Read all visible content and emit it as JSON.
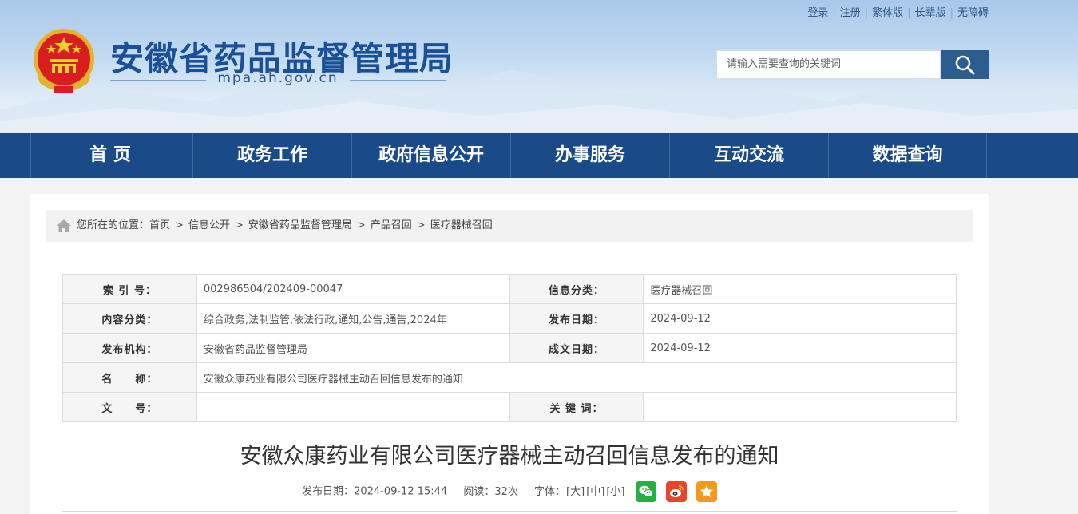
{
  "toplinks": [
    "登录",
    "注册",
    "繁体版",
    "长辈版",
    "无障碍"
  ],
  "site": {
    "title": "安徽省药品监督管理局",
    "domain": "mpa.ah.gov.cn"
  },
  "search": {
    "placeholder": "请输入需要查询的关键词"
  },
  "nav": [
    "首 页",
    "政务工作",
    "政府信息公开",
    "办事服务",
    "互动交流",
    "数据查询"
  ],
  "breadcrumb": {
    "prefix": "您所在的位置：",
    "items": [
      "首页",
      "信息公开",
      "安徽省药品监督管理局",
      "产品召回",
      "医疗器械召回"
    ],
    "separator": ">"
  },
  "meta": {
    "index_label": "索 引 号：",
    "index_value": "002986504/202409-00047",
    "category_label": "信息分类：",
    "category_value": "医疗器械召回",
    "content_label": "内容分类：",
    "content_value": "综合政务,法制监管,依法行政,通知,公告,通告,2024年",
    "pubdate_label": "发布日期：",
    "pubdate_value": "2024-09-12",
    "org_label": "发布机构：",
    "org_value": "安徽省药品监督管理局",
    "writedate_label": "成文日期：",
    "writedate_value": "2024-09-12",
    "name_label": "名　　称：",
    "name_value": "安徽众康药业有限公司医疗器械主动召回信息发布的通知",
    "docno_label": "文　　号：",
    "docno_value": "",
    "keyword_label": "关 键 词：",
    "keyword_value": ""
  },
  "article": {
    "title": "安徽众康药业有限公司医疗器械主动召回信息发布的通知",
    "date_label": "发布日期：2024-09-12 15:44",
    "reads_label": "阅读：32次",
    "fontsize_label": "字体：",
    "font_large": "[大]",
    "font_medium": "[中]",
    "font_small": "[小]"
  },
  "colors": {
    "nav_bg": "#1a4a87",
    "title_blue": "#1b5096",
    "wechat": "#2aae44",
    "weibo": "#e8452c",
    "favorite": "#f39a1e"
  },
  "icons": {
    "home": "home-icon",
    "search": "search-icon",
    "wechat": "wechat-icon",
    "weibo": "weibo-icon",
    "favorite": "star-icon"
  }
}
